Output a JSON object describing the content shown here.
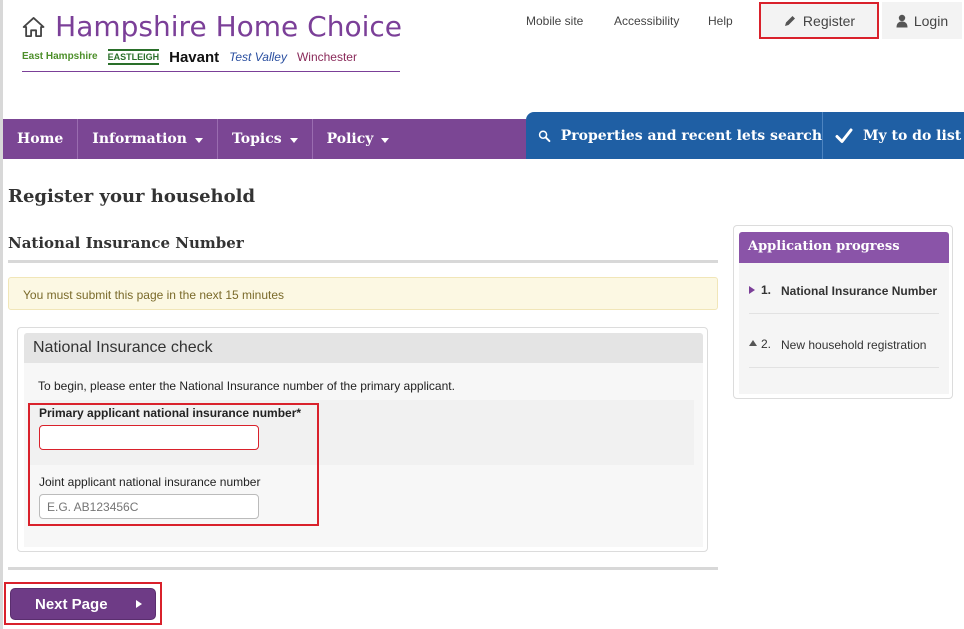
{
  "header": {
    "site_title": "Hampshire Home Choice",
    "councils": [
      "East Hampshire",
      "EASTLEIGH",
      "Havant",
      "Test Valley",
      "Winchester"
    ],
    "links": {
      "mobile": "Mobile site",
      "accessibility": "Accessibility",
      "help": "Help",
      "register": "Register",
      "login": "Login"
    }
  },
  "nav": {
    "home": "Home",
    "information": "Information",
    "topics": "Topics",
    "policy": "Policy",
    "search": "Properties and recent lets search",
    "todo": "My to do list"
  },
  "main": {
    "page_heading": "Register your household",
    "section_heading": "National Insurance Number",
    "notice": "You must submit this page in the next 15 minutes",
    "panel": {
      "title": "National Insurance check",
      "intro": "To begin, please enter the National Insurance number of the primary applicant.",
      "primary_label": "Primary applicant national insurance number*",
      "primary_value": "",
      "joint_label": "Joint applicant national insurance number",
      "joint_placeholder": "E.G. AB123456C"
    },
    "next_button": "Next Page"
  },
  "sidebar": {
    "title": "Application progress",
    "steps": [
      {
        "num": "1.",
        "label": "National Insurance Number"
      },
      {
        "num": "2.",
        "label": "New household registration"
      }
    ]
  },
  "colors": {
    "brand_purple": "#7b4694",
    "nav_blue": "#1f5fa4",
    "highlight_red": "#d9212b"
  }
}
